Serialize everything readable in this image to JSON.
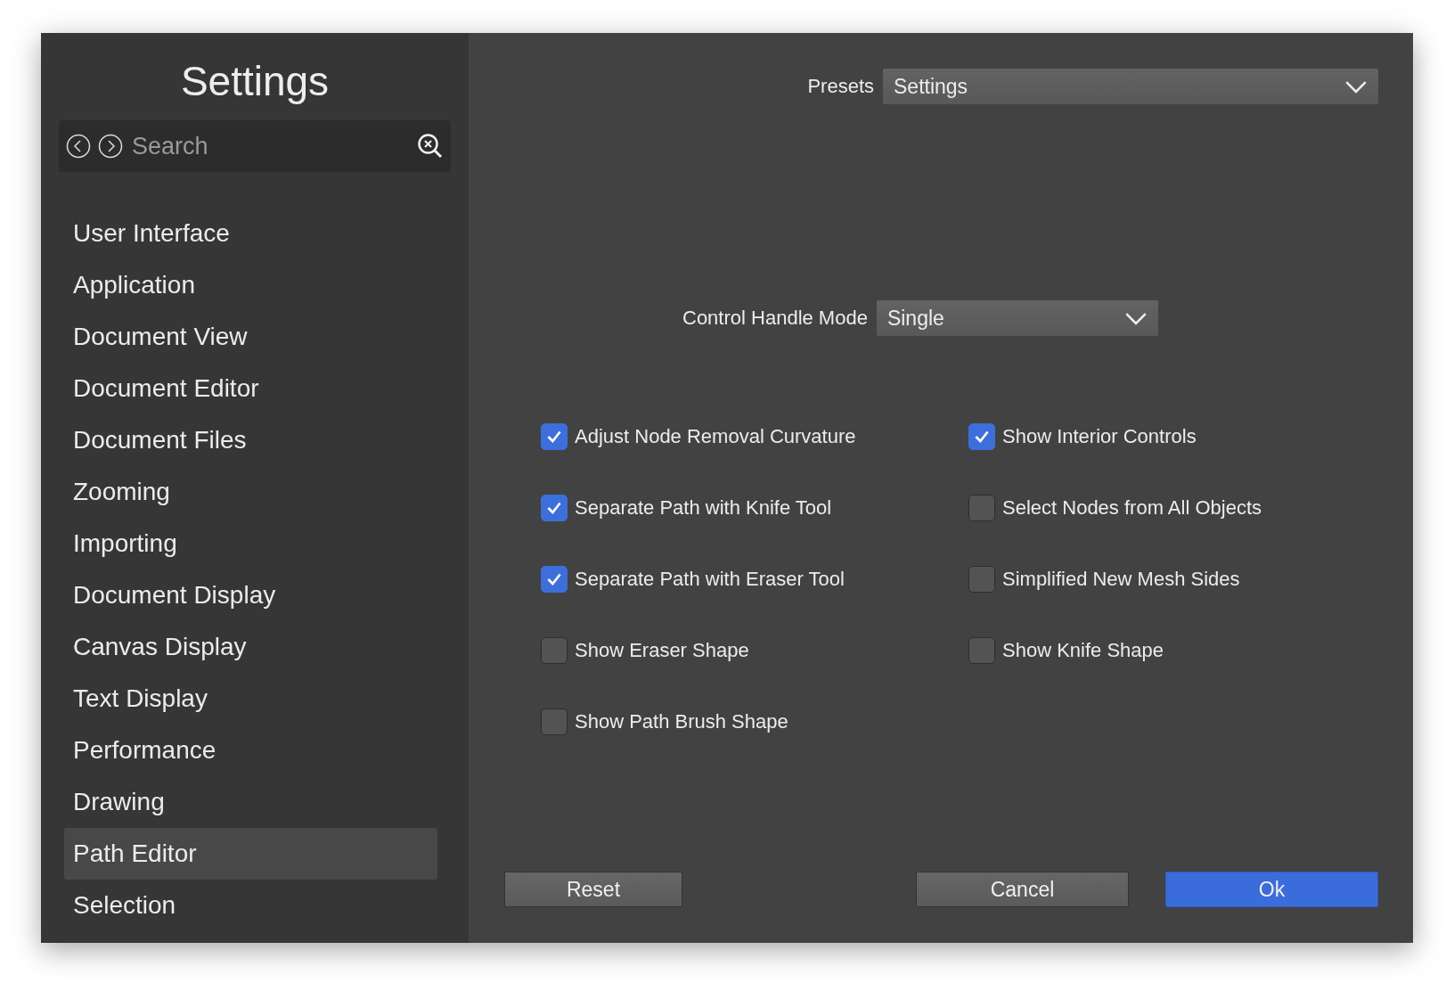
{
  "window": {
    "title": "Settings"
  },
  "search": {
    "placeholder": "Search"
  },
  "sidebar": {
    "items": [
      {
        "label": "User Interface",
        "selected": false
      },
      {
        "label": "Application",
        "selected": false
      },
      {
        "label": "Document View",
        "selected": false
      },
      {
        "label": "Document Editor",
        "selected": false
      },
      {
        "label": "Document Files",
        "selected": false
      },
      {
        "label": "Zooming",
        "selected": false
      },
      {
        "label": "Importing",
        "selected": false
      },
      {
        "label": "Document Display",
        "selected": false
      },
      {
        "label": "Canvas Display",
        "selected": false
      },
      {
        "label": "Text Display",
        "selected": false
      },
      {
        "label": "Performance",
        "selected": false
      },
      {
        "label": "Drawing",
        "selected": false
      },
      {
        "label": "Path Editor",
        "selected": true
      },
      {
        "label": "Selection",
        "selected": false
      }
    ]
  },
  "presets": {
    "label": "Presets",
    "value": "Settings"
  },
  "control_handle_mode": {
    "label": "Control Handle Mode",
    "value": "Single"
  },
  "options": {
    "column_1": [
      {
        "label": "Adjust Node Removal Curvature",
        "checked": true
      },
      {
        "label": "Separate Path with Knife Tool",
        "checked": true
      },
      {
        "label": "Separate Path with Eraser Tool",
        "checked": true
      },
      {
        "label": "Show Eraser Shape",
        "checked": false
      },
      {
        "label": "Show Path Brush Shape",
        "checked": false
      }
    ],
    "column_2": [
      {
        "label": "Show Interior Controls",
        "checked": true
      },
      {
        "label": "Select Nodes from All Objects",
        "checked": false
      },
      {
        "label": "Simplified New Mesh Sides",
        "checked": false
      },
      {
        "label": "Show Knife Shape",
        "checked": false
      }
    ]
  },
  "buttons": [
    {
      "label": "Reset",
      "kind": "secondary"
    },
    {
      "label": "Cancel",
      "kind": "secondary"
    },
    {
      "label": "Ok",
      "kind": "primary"
    }
  ]
}
